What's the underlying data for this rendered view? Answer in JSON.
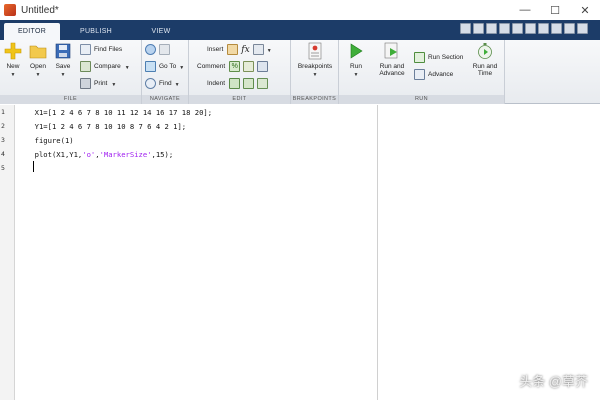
{
  "window": {
    "title": "Untitled*",
    "controls": [
      "—",
      "☐",
      "✕"
    ]
  },
  "tabs": [
    {
      "label": "EDITOR",
      "active": true
    },
    {
      "label": "PUBLISH",
      "active": false
    },
    {
      "label": "VIEW",
      "active": false
    }
  ],
  "ribbon": {
    "file": {
      "label": "FILE",
      "new": "New",
      "open": "Open",
      "save": "Save",
      "find_files": "Find Files",
      "compare": "Compare",
      "print": "Print"
    },
    "navigate": {
      "label": "NAVIGATE",
      "go_to": "Go To",
      "find": "Find"
    },
    "edit": {
      "label": "EDIT",
      "insert": "Insert",
      "fx": "fx",
      "comment": "Comment",
      "comment_pct": "%",
      "indent": "Indent"
    },
    "breakpoints": {
      "label": "BREAKPOINTS",
      "breakpoints": "Breakpoints"
    },
    "run": {
      "label": "RUN",
      "run": "Run",
      "run_and_advance_1": "Run and",
      "run_and_advance_2": "Advance",
      "run_section": "Run Section",
      "advance": "Advance",
      "run_and_time_1": "Run and",
      "run_and_time_2": "Time"
    }
  },
  "editor": {
    "line_numbers": [
      "1",
      "2",
      "3",
      "4",
      "5"
    ],
    "lines": [
      "  X1=[1 2 4 6 7 8 10 11 12 14 16 17 18 20];",
      "  Y1=[1 2 4 6 7 8 10 10 8 7 6 4 2 1];",
      "  figure(1)",
      "  plot(X1,Y1,",
      ""
    ],
    "plot_args": [
      "'o'",
      ",",
      "'MarkerSize'",
      ",15);"
    ]
  },
  "watermark": "头条 @草芥",
  "colors": {
    "tab_bar": "#1c3c68",
    "string_literal": "#a020f0"
  }
}
